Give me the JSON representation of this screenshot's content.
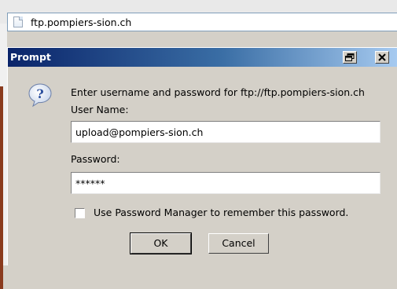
{
  "browser": {
    "url": "ftp.pompiers-sion.ch"
  },
  "dialog": {
    "title": "Prompt",
    "message": "Enter username and password for ftp://ftp.pompiers-sion.ch",
    "username_label": "User Name:",
    "username_value": "upload@pompiers-sion.ch",
    "password_label": "Password:",
    "password_value": "******",
    "remember_label": "Use Password Manager to remember this password.",
    "remember_checked": false,
    "ok_label": "OK",
    "cancel_label": "Cancel"
  },
  "colors": {
    "titlebar_start": "#0a246a",
    "titlebar_end": "#a6caf0",
    "dialog_bg": "#d4d0c8"
  }
}
